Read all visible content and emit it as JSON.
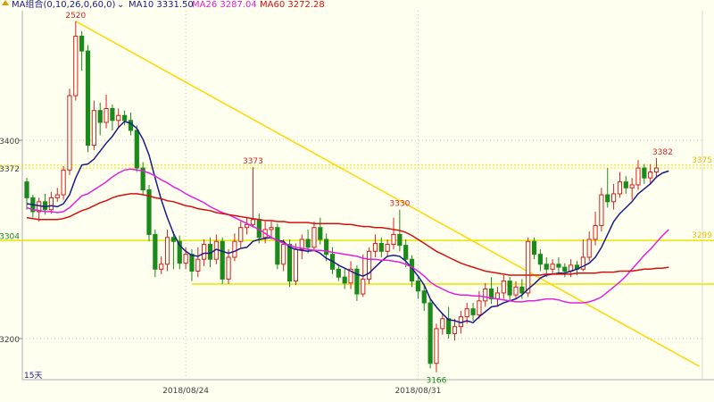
{
  "legend": {
    "indicator": "MA组合(0,10,26,0,60,0)",
    "dropdown_glyph": "⌄",
    "ma10": "MA10 3331.50",
    "ma26": "MA26 3287.04",
    "ma60": "MA60 3272.28"
  },
  "colors": {
    "background": "#fffff0",
    "up": "#d42020",
    "down": "#1a8a1a",
    "ma10": "#1a1a8a",
    "ma26": "#e020e0",
    "ma60": "#d41010",
    "trend": "#ffd700",
    "hline": "#e6e600",
    "axis_text": "#404040"
  },
  "chart_data": {
    "type": "candlestick",
    "period_label": "15天",
    "y_ticks": [
      3400,
      3200
    ],
    "ylim": [
      3160,
      3530
    ],
    "x_labels": [
      {
        "index": 26,
        "label": "2018/08/24"
      },
      {
        "index": 64,
        "label": "2018/08/31"
      }
    ],
    "price_labels": [
      {
        "value": 3372,
        "text": "3372",
        "side": "left",
        "color": "#404040"
      },
      {
        "value": 3304,
        "text": "3304",
        "side": "left",
        "color": "#1a8a1a"
      },
      {
        "value": 3375,
        "text": "3375",
        "side": "right",
        "color": "#e6c200"
      },
      {
        "value": 3299,
        "text": "3299",
        "side": "right",
        "color": "#e6c200"
      }
    ],
    "annotations": [
      {
        "index": 8,
        "value": 3520,
        "text": "2520",
        "color": "#d42020",
        "pos": "above"
      },
      {
        "index": 37,
        "value": 3373,
        "text": "3373",
        "color": "#d42020",
        "pos": "above"
      },
      {
        "index": 61,
        "value": 3330,
        "text": "3330",
        "color": "#d42020",
        "pos": "above"
      },
      {
        "index": 104,
        "value": 3382,
        "text": "3382",
        "color": "#d42020",
        "pos": "above"
      },
      {
        "index": 67,
        "value": 3166,
        "text": "3166",
        "color": "#1a8a1a",
        "pos": "below"
      }
    ],
    "horizontal_lines": [
      3375,
      3372,
      3299,
      3255
    ],
    "trendline": {
      "from": [
        8,
        3520
      ],
      "to": [
        110,
        3172
      ]
    },
    "candles": [
      [
        3358,
        3342,
        3362,
        3330
      ],
      [
        3342,
        3328,
        3345,
        3322
      ],
      [
        3328,
        3338,
        3342,
        3318
      ],
      [
        3338,
        3330,
        3346,
        3325
      ],
      [
        3330,
        3342,
        3348,
        3326
      ],
      [
        3342,
        3345,
        3352,
        3338
      ],
      [
        3345,
        3370,
        3374,
        3340
      ],
      [
        3370,
        3445,
        3452,
        3365
      ],
      [
        3445,
        3505,
        3520,
        3440
      ],
      [
        3505,
        3490,
        3510,
        3470
      ],
      [
        3490,
        3395,
        3496,
        3388
      ],
      [
        3395,
        3430,
        3440,
        3390
      ],
      [
        3430,
        3418,
        3438,
        3405
      ],
      [
        3418,
        3432,
        3446,
        3412
      ],
      [
        3432,
        3420,
        3436,
        3410
      ],
      [
        3420,
        3425,
        3432,
        3412
      ],
      [
        3425,
        3420,
        3430,
        3415
      ],
      [
        3420,
        3410,
        3428,
        3405
      ],
      [
        3410,
        3372,
        3415,
        3368
      ],
      [
        3372,
        3350,
        3378,
        3345
      ],
      [
        3350,
        3305,
        3355,
        3298
      ],
      [
        3305,
        3270,
        3310,
        3262
      ],
      [
        3270,
        3275,
        3283,
        3265
      ],
      [
        3275,
        3302,
        3310,
        3268
      ],
      [
        3302,
        3298,
        3308,
        3270
      ],
      [
        3298,
        3276,
        3304,
        3270
      ],
      [
        3276,
        3285,
        3292,
        3270
      ],
      [
        3285,
        3268,
        3290,
        3258
      ],
      [
        3268,
        3280,
        3292,
        3262
      ],
      [
        3280,
        3295,
        3300,
        3273
      ],
      [
        3295,
        3280,
        3302,
        3272
      ],
      [
        3280,
        3298,
        3305,
        3275
      ],
      [
        3298,
        3260,
        3302,
        3255
      ],
      [
        3260,
        3282,
        3290,
        3255
      ],
      [
        3282,
        3298,
        3306,
        3278
      ],
      [
        3298,
        3312,
        3318,
        3292
      ],
      [
        3312,
        3315,
        3322,
        3305
      ],
      [
        3315,
        3320,
        3373,
        3312
      ],
      [
        3320,
        3302,
        3326,
        3296
      ],
      [
        3302,
        3310,
        3318,
        3296
      ],
      [
        3310,
        3312,
        3318,
        3300
      ],
      [
        3312,
        3275,
        3316,
        3270
      ],
      [
        3275,
        3295,
        3300,
        3268
      ],
      [
        3295,
        3258,
        3300,
        3252
      ],
      [
        3258,
        3290,
        3296,
        3254
      ],
      [
        3290,
        3300,
        3305,
        3280
      ],
      [
        3300,
        3292,
        3310,
        3286
      ],
      [
        3292,
        3312,
        3318,
        3288
      ],
      [
        3312,
        3300,
        3322,
        3295
      ],
      [
        3300,
        3285,
        3306,
        3278
      ],
      [
        3285,
        3270,
        3292,
        3265
      ],
      [
        3270,
        3262,
        3275,
        3258
      ],
      [
        3262,
        3256,
        3270,
        3250
      ],
      [
        3256,
        3270,
        3278,
        3250
      ],
      [
        3270,
        3245,
        3274,
        3238
      ],
      [
        3245,
        3260,
        3285,
        3242
      ],
      [
        3260,
        3288,
        3292,
        3255
      ],
      [
        3288,
        3296,
        3305,
        3282
      ],
      [
        3296,
        3288,
        3302,
        3282
      ],
      [
        3288,
        3295,
        3300,
        3282
      ],
      [
        3295,
        3305,
        3322,
        3290
      ],
      [
        3305,
        3294,
        3330,
        3288
      ],
      [
        3294,
        3280,
        3300,
        3272
      ],
      [
        3280,
        3258,
        3284,
        3252
      ],
      [
        3258,
        3248,
        3262,
        3240
      ],
      [
        3248,
        3236,
        3254,
        3228
      ],
      [
        3236,
        3175,
        3240,
        3170
      ],
      [
        3175,
        3210,
        3215,
        3166
      ],
      [
        3210,
        3220,
        3226,
        3204
      ],
      [
        3220,
        3205,
        3232,
        3200
      ],
      [
        3205,
        3212,
        3220,
        3198
      ],
      [
        3212,
        3222,
        3228,
        3205
      ],
      [
        3222,
        3230,
        3236,
        3215
      ],
      [
        3230,
        3224,
        3236,
        3218
      ],
      [
        3224,
        3238,
        3248,
        3220
      ],
      [
        3238,
        3250,
        3256,
        3232
      ],
      [
        3250,
        3240,
        3262,
        3235
      ],
      [
        3240,
        3246,
        3252,
        3232
      ],
      [
        3246,
        3258,
        3264,
        3240
      ],
      [
        3258,
        3244,
        3262,
        3238
      ],
      [
        3244,
        3252,
        3258,
        3240
      ],
      [
        3252,
        3246,
        3260,
        3240
      ],
      [
        3246,
        3298,
        3302,
        3242
      ],
      [
        3298,
        3285,
        3302,
        3280
      ],
      [
        3285,
        3275,
        3290,
        3268
      ],
      [
        3275,
        3270,
        3282,
        3262
      ],
      [
        3270,
        3275,
        3280,
        3265
      ],
      [
        3275,
        3272,
        3282,
        3266
      ],
      [
        3272,
        3268,
        3276,
        3262
      ],
      [
        3268,
        3274,
        3280,
        3262
      ],
      [
        3274,
        3270,
        3278,
        3264
      ],
      [
        3270,
        3282,
        3300,
        3268
      ],
      [
        3282,
        3300,
        3308,
        3278
      ],
      [
        3300,
        3314,
        3328,
        3294
      ],
      [
        3314,
        3345,
        3352,
        3308
      ],
      [
        3345,
        3338,
        3372,
        3332
      ],
      [
        3338,
        3346,
        3356,
        3330
      ],
      [
        3346,
        3358,
        3368,
        3342
      ],
      [
        3358,
        3352,
        3364,
        3346
      ],
      [
        3352,
        3355,
        3362,
        3340
      ],
      [
        3355,
        3372,
        3380,
        3350
      ],
      [
        3372,
        3362,
        3376,
        3356
      ],
      [
        3362,
        3368,
        3376,
        3356
      ],
      [
        3368,
        3372,
        3382,
        3362
      ]
    ],
    "series": [
      {
        "name": "MA10",
        "values": [
          3336,
          3335,
          3334,
          3333,
          3334,
          3333,
          3336,
          3345,
          3362,
          3375,
          3376,
          3381,
          3389,
          3397,
          3404,
          3413,
          3419,
          3417,
          3412,
          3401,
          3385,
          3362,
          3340,
          3322,
          3306,
          3294,
          3288,
          3284,
          3283,
          3286,
          3286,
          3290,
          3288,
          3286,
          3288,
          3291,
          3292,
          3298,
          3300,
          3301,
          3302,
          3299,
          3298,
          3292,
          3290,
          3289,
          3288,
          3289,
          3286,
          3281,
          3278,
          3274,
          3271,
          3268,
          3265,
          3263,
          3266,
          3272,
          3278,
          3283,
          3284,
          3283,
          3278,
          3271,
          3263,
          3254,
          3240,
          3232,
          3225,
          3219,
          3218,
          3216,
          3218,
          3216,
          3222,
          3227,
          3232,
          3233,
          3236,
          3238,
          3240,
          3244,
          3250,
          3255,
          3261,
          3264,
          3265,
          3266,
          3266,
          3268,
          3270,
          3273,
          3276,
          3282,
          3292,
          3305,
          3318,
          3326,
          3332,
          3338,
          3346,
          3351,
          3356,
          3363,
          3367,
          3369
        ]
      },
      {
        "name": "MA26",
        "values": [
          3332,
          3330,
          3329,
          3328,
          3328,
          3327,
          3328,
          3332,
          3338,
          3344,
          3346,
          3350,
          3354,
          3358,
          3363,
          3367,
          3370,
          3371,
          3370,
          3369,
          3367,
          3364,
          3360,
          3357,
          3353,
          3350,
          3346,
          3343,
          3340,
          3337,
          3333,
          3330,
          3327,
          3325,
          3322,
          3319,
          3316,
          3313,
          3310,
          3306,
          3302,
          3299,
          3296,
          3294,
          3292,
          3291,
          3290,
          3289,
          3289,
          3288,
          3287,
          3286,
          3285,
          3284,
          3283,
          3281,
          3280,
          3280,
          3279,
          3279,
          3278,
          3277,
          3275,
          3272,
          3268,
          3263,
          3257,
          3253,
          3250,
          3247,
          3245,
          3244,
          3244,
          3243,
          3243,
          3242,
          3241,
          3240,
          3239,
          3238,
          3237,
          3237,
          3238,
          3238,
          3239,
          3240,
          3240,
          3239,
          3237,
          3236,
          3236,
          3236,
          3237,
          3239,
          3242,
          3247,
          3252,
          3257,
          3263,
          3270,
          3277,
          3284,
          3290,
          3297,
          3304,
          3310
        ]
      },
      {
        "name": "MA60",
        "values": [
          3322,
          3321,
          3320,
          3320,
          3320,
          3320,
          3321,
          3323,
          3326,
          3329,
          3331,
          3334,
          3337,
          3339,
          3342,
          3344,
          3345,
          3346,
          3346,
          3345,
          3344,
          3342,
          3341,
          3339,
          3338,
          3336,
          3334,
          3333,
          3331,
          3330,
          3329,
          3327,
          3326,
          3325,
          3324,
          3323,
          3322,
          3321,
          3320,
          3319,
          3319,
          3318,
          3318,
          3317,
          3317,
          3317,
          3317,
          3316,
          3316,
          3316,
          3316,
          3316,
          3315,
          3315,
          3314,
          3313,
          3313,
          3312,
          3312,
          3311,
          3310,
          3309,
          3307,
          3304,
          3300,
          3296,
          3292,
          3288,
          3285,
          3282,
          3279,
          3276,
          3274,
          3272,
          3270,
          3268,
          3267,
          3266,
          3265,
          3264,
          3264,
          3264,
          3264,
          3264,
          3264,
          3265,
          3265,
          3265,
          3265,
          3265,
          3266,
          3266,
          3266,
          3266,
          3267,
          3267,
          3267,
          3268,
          3268,
          3268,
          3269,
          3270,
          3270,
          3271,
          3271,
          3272
        ]
      }
    ]
  }
}
